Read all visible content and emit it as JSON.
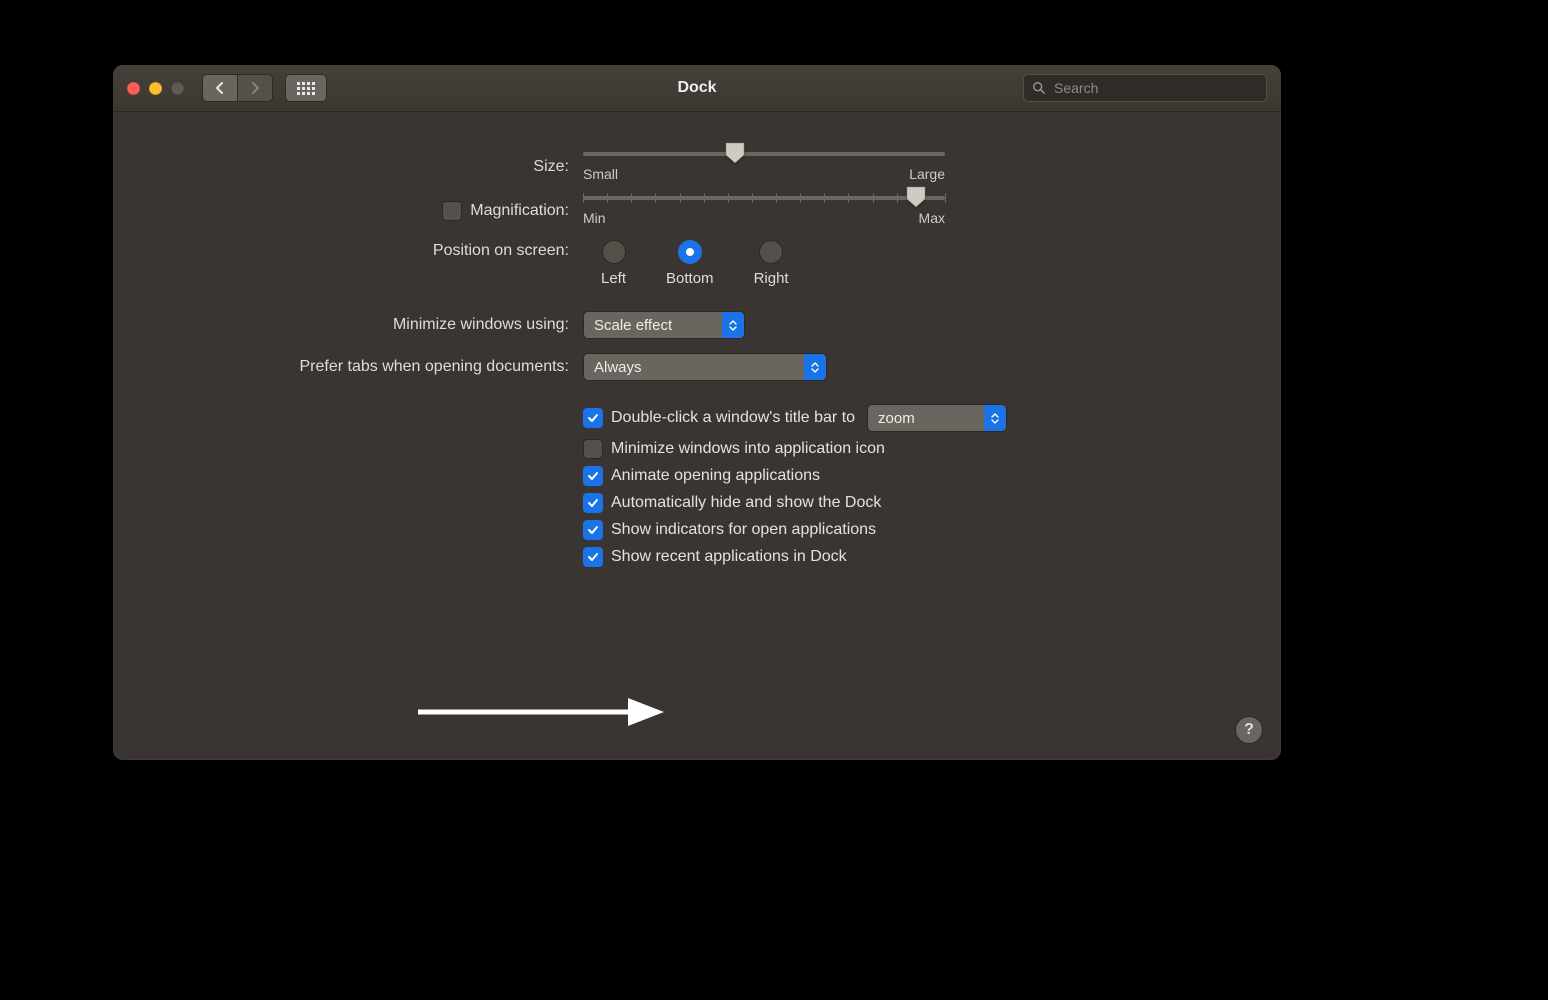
{
  "window": {
    "title": "Dock"
  },
  "search": {
    "placeholder": "Search"
  },
  "labels": {
    "size": "Size:",
    "magnification": "Magnification:",
    "position": "Position on screen:",
    "minimize_using": "Minimize windows using:",
    "prefer_tabs": "Prefer tabs when opening documents:"
  },
  "slider_labels": {
    "size_min": "Small",
    "size_max": "Large",
    "mag_min": "Min",
    "mag_max": "Max"
  },
  "sliders": {
    "size_percent": 42,
    "magnification_percent": 92
  },
  "position_options": {
    "left": "Left",
    "bottom": "Bottom",
    "right": "Right"
  },
  "position_selected": "bottom",
  "minimize_effect": "Scale effect",
  "prefer_tabs_value": "Always",
  "magnification_enabled": false,
  "checks": {
    "double_click_label": "Double-click a window's title bar to",
    "double_click_action": "zoom",
    "double_click_checked": true,
    "minimize_into_icon_label": "Minimize windows into application icon",
    "minimize_into_icon_checked": false,
    "animate_label": "Animate opening applications",
    "animate_checked": true,
    "autohide_label": "Automatically hide and show the Dock",
    "autohide_checked": true,
    "indicators_label": "Show indicators for open applications",
    "indicators_checked": true,
    "recent_label": "Show recent applications in Dock",
    "recent_checked": true
  },
  "help_label": "?"
}
